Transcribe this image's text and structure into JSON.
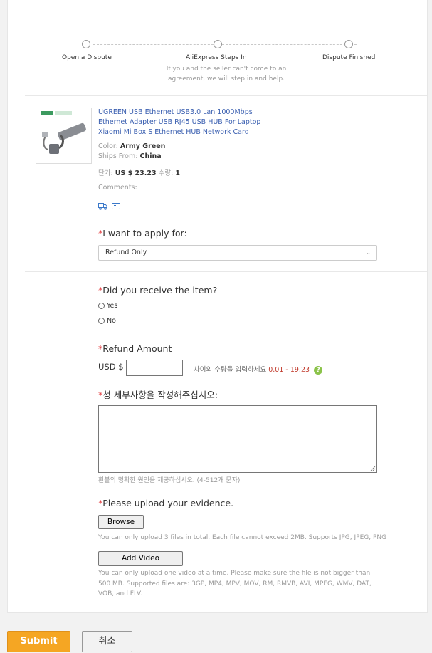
{
  "steps": [
    {
      "label": "Open a Dispute"
    },
    {
      "label": "AliExpress Steps In",
      "description": "If you and the seller can't come to an agreement, we will step in and help."
    },
    {
      "label": "Dispute Finished"
    }
  ],
  "product": {
    "title": "UGREEN USB Ethernet USB3.0 Lan 1000Mbps Ethernet Adapter USB RJ45 USB HUB For Laptop Xiaomi Mi Box S Ethernet HUB Network Card",
    "color_label": "Color:",
    "color_value": "Army Green",
    "ships_label": "Ships From:",
    "ships_value": "China",
    "price_label": "단가:",
    "price_value": "US $ 23.23",
    "qty_label": "수량:",
    "qty_value": "1",
    "comments_label": "Comments:",
    "icons": [
      "truck-icon",
      "message-icon"
    ]
  },
  "apply": {
    "label": "I want to apply for:",
    "selected": "Refund Only"
  },
  "received": {
    "label": "Did you receive the item?",
    "options": [
      "Yes",
      "No"
    ]
  },
  "refund": {
    "label": "Refund Amount",
    "currency": "USD $",
    "hint": "사이의 수량을 입력하세요",
    "range": "0.01 - 19.23"
  },
  "details": {
    "label": "청 세부사항을 작성해주십시오:",
    "hint": "환불의 명확한 원인을 제공하십시오. (4-512개 문자)"
  },
  "evidence": {
    "label": "Please upload your evidence.",
    "browse_label": "Browse",
    "browse_hint": "You can only upload 3 files in total. Each file cannot exceed 2MB. Supports JPG, JPEG, PNG",
    "video_label": "Add Video",
    "video_hint": "You can only upload one video at a time. Please make sure the file is not bigger than 500 MB. Supported files are: 3GP, MP4, MPV, MOV, RM, RMVB, AVI, MPEG, WMV, DAT, VOB, and FLV."
  },
  "actions": {
    "submit": "Submit",
    "cancel": "취소"
  },
  "colors": {
    "accent": "#f5a623",
    "link": "#3a5fb0",
    "required": "#e4393c"
  }
}
